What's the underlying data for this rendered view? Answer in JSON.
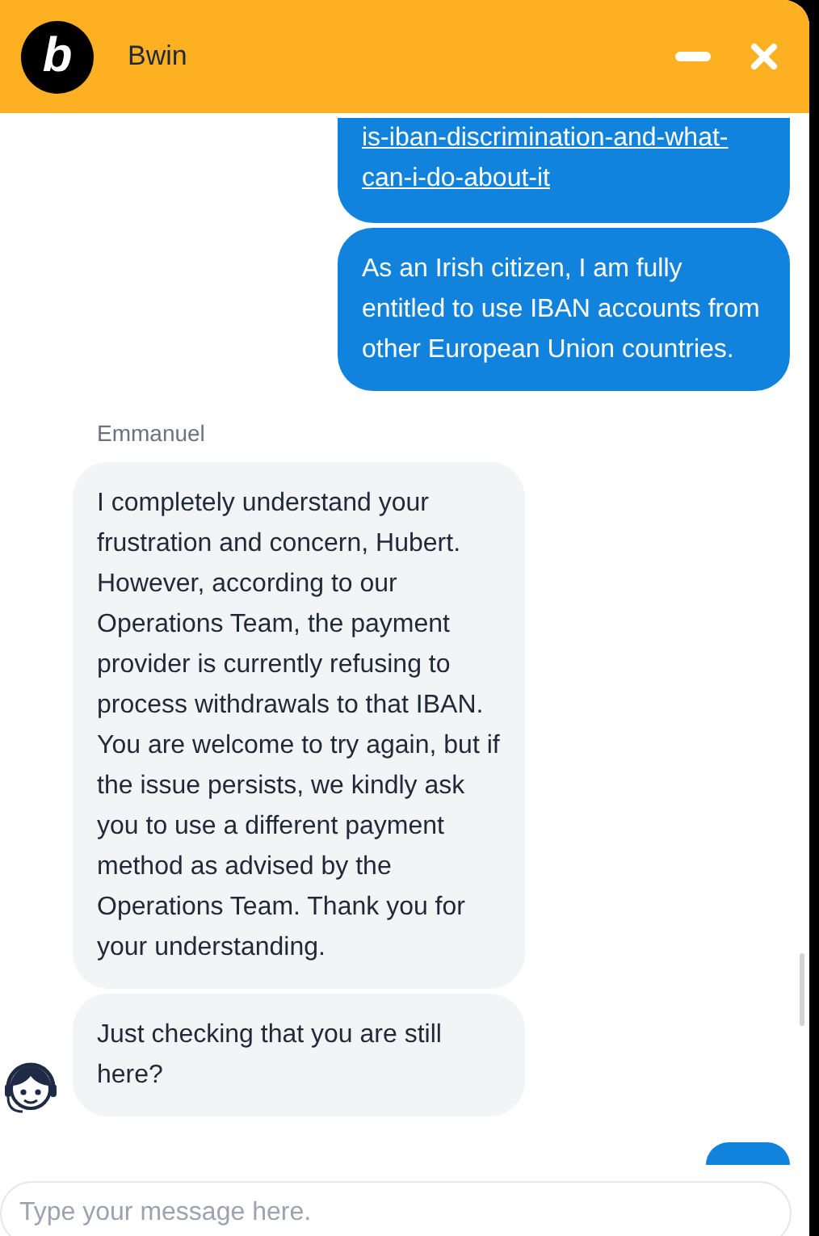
{
  "header": {
    "logo": "b",
    "title": "Bwin"
  },
  "messages": [
    {
      "outgoing": true,
      "kind": "link",
      "text": "is-iban-discrimination-and-what-can-i-do-about-it"
    },
    {
      "outgoing": true,
      "kind": "text",
      "text": "As an Irish citizen, I am fully entitled to use IBAN accounts from other European Union countries."
    },
    {
      "outgoing": false,
      "kind": "text",
      "author": "Emmanuel",
      "text": "I completely understand your frustration and concern, Hubert. However, according to our Operations Team, the payment provider is currently refusing to process withdrawals to that IBAN. You are welcome to try again, but if the issue persists, we kindly ask you to use a different payment method as advised by the Operations Team. Thank you for your understanding."
    },
    {
      "outgoing": false,
      "kind": "text",
      "avatar": true,
      "text": "Just checking that you are still here?"
    }
  ],
  "composer": {
    "placeholder": "Type your message here."
  }
}
